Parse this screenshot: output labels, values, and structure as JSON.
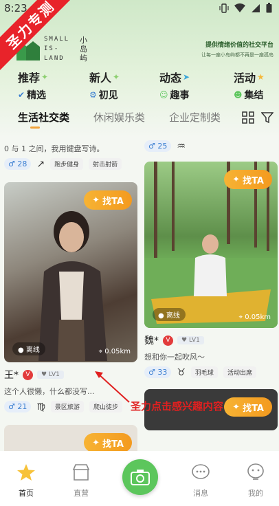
{
  "status": {
    "time": "8:23"
  },
  "banner": "圣力专测",
  "logo": {
    "line1": "SMALL",
    "line2": "IS-",
    "line3": "LAND",
    "cn": "小岛屿"
  },
  "slogan": {
    "main": "提供情绪价值的社交平台",
    "sub": "让每一座小岛屿都不再是一座孤岛"
  },
  "categories": [
    {
      "main": "推荐",
      "sub": "精选"
    },
    {
      "main": "新人",
      "sub": "初见"
    },
    {
      "main": "动态",
      "sub": "趣事"
    },
    {
      "main": "活动",
      "sub": "集结"
    }
  ],
  "tabs": [
    "生活社交类",
    "休闲娱乐类",
    "企业定制类"
  ],
  "feed": {
    "top_left": {
      "text": "0 与 1 之间，我用键盘写诗。",
      "age": "28",
      "tags": [
        "跑步健身",
        "射击射箭"
      ]
    },
    "top_right": {
      "age": "25"
    },
    "find_ta": "找TA",
    "card_left": {
      "offline": "离线",
      "distance": "0.05km",
      "name": "王*",
      "level": "LV1",
      "bio": "这个人很懒，什么都没写...",
      "age": "21",
      "tags": [
        "景区旅游",
        "爬山徒步"
      ]
    },
    "card_right": {
      "offline": "离线",
      "distance": "0.05km",
      "name": "魏*",
      "level": "LV1",
      "bio": "想和你一起吹风～",
      "age": "33",
      "tags": [
        "羽毛球",
        "活动出席"
      ]
    }
  },
  "annotation": "圣力点击感兴趣内容",
  "nav": [
    "首页",
    "直营",
    "消息",
    "我的"
  ],
  "colors": {
    "accent": "#f39a1f",
    "brand_green": "#5cc65c",
    "annotation_red": "#e02020"
  }
}
